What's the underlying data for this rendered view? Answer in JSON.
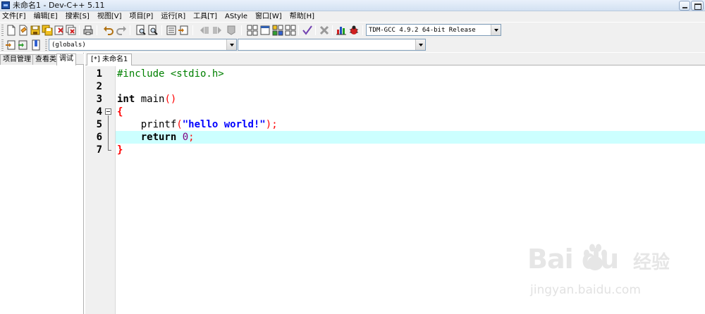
{
  "window": {
    "title": "未命名1 - Dev-C++ 5.11"
  },
  "menu": [
    "文件[F]",
    "编辑[E]",
    "搜索[S]",
    "视图[V]",
    "项目[P]",
    "运行[R]",
    "工具[T]",
    "AStyle",
    "窗口[W]",
    "帮助[H]"
  ],
  "toolbar": {
    "compiler_select": "TDM-GCC 4.9.2 64-bit Release",
    "scope_select": "(globals)",
    "member_select": ""
  },
  "left_panel": {
    "tabs": [
      "项目管理",
      "查看类",
      "调试"
    ],
    "active_tab": 2
  },
  "editor": {
    "tab_label": "[*] 未命名1",
    "current_line": 6,
    "lines": [
      {
        "number": "1",
        "text": "#include <stdio.h>"
      },
      {
        "number": "2",
        "text": ""
      },
      {
        "number": "3",
        "text": "int main()"
      },
      {
        "number": "4",
        "text": "{"
      },
      {
        "number": "5",
        "text": "    printf(\"hello world!\");"
      },
      {
        "number": "6",
        "text": "    return 0;"
      },
      {
        "number": "7",
        "text": "}"
      }
    ]
  },
  "watermark": {
    "logo": "Bai du",
    "text": "经验",
    "url": "jingyan.baidu.com"
  },
  "colors": {
    "current_line": "#ccffff",
    "preprocessor": "#008000",
    "string": "#0000ff",
    "number": "#800080",
    "symbol": "#ff0000"
  }
}
